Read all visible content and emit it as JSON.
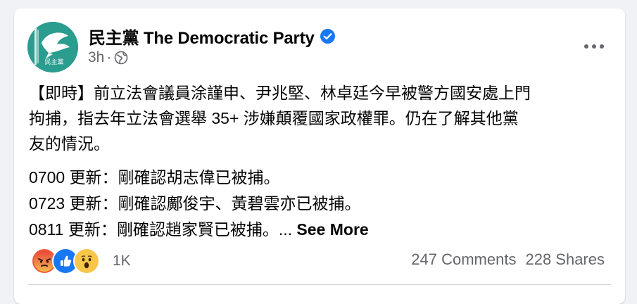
{
  "post": {
    "author": "民主黨 The Democratic Party",
    "time": "3h",
    "dot": "·",
    "body_lines": [
      "【即時】前立法會議員涂謹申、尹兆堅、林卓廷今早被警方國安處上門",
      "拘捕，指去年立法會選舉 35+ 涉嫌顛覆國家政權罪。仍在了解其他黨",
      "友的情況。"
    ],
    "updates": [
      "0700 更新：剛確認胡志偉已被捕。",
      "0723 更新：剛確認鄺俊宇、黃碧雲亦已被捕。",
      "0811 更新：剛確認趙家賢已被捕。..."
    ],
    "see_more": "See More",
    "avatar_label": "民主黨"
  },
  "engagement": {
    "reaction_count": "1K",
    "comments": "247 Comments",
    "shares": "228 Shares"
  },
  "icons": {
    "verified": "verified-badge-icon",
    "audience": "globe-icon",
    "more": "more-options-icon",
    "reactions": [
      "angry-icon",
      "like-icon",
      "wow-icon"
    ]
  },
  "colors": {
    "brand_green": "#2a9d8f",
    "facebook_blue": "#1877f2",
    "secondary_text": "#65676b"
  }
}
